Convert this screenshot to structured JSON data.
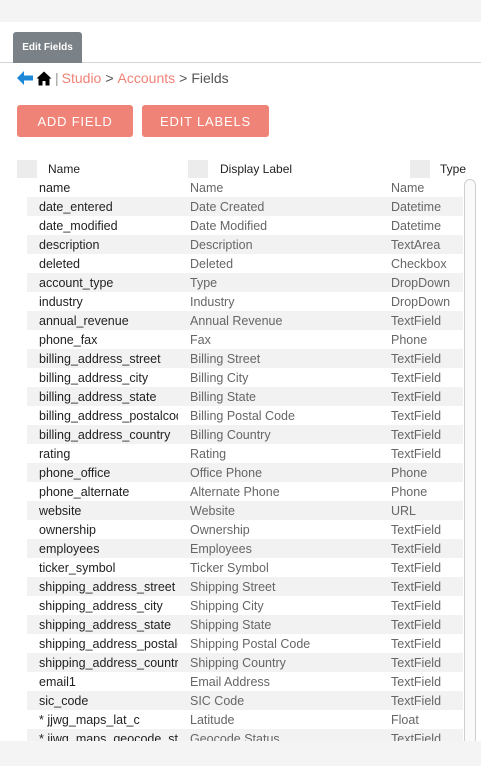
{
  "tab": {
    "label": "Edit Fields"
  },
  "breadcrumb": {
    "back_icon": "back-arrow-icon",
    "home_icon": "home-icon",
    "separator": "|",
    "studio": "Studio",
    "gt1": ">",
    "accounts": "Accounts",
    "gt2": ">",
    "current": "Fields"
  },
  "buttons": {
    "add_field": "ADD FIELD",
    "edit_labels": "EDIT LABELS"
  },
  "colors": {
    "accent": "#f08377",
    "tab": "#7a8288"
  },
  "table": {
    "headers": {
      "name": "Name",
      "label": "Display Label",
      "type": "Type"
    },
    "rows": [
      {
        "name": "name",
        "label": "Name",
        "type": "Name"
      },
      {
        "name": "date_entered",
        "label": "Date Created",
        "type": "Datetime"
      },
      {
        "name": "date_modified",
        "label": "Date Modified",
        "type": "Datetime"
      },
      {
        "name": "description",
        "label": "Description",
        "type": "TextArea"
      },
      {
        "name": "deleted",
        "label": "Deleted",
        "type": "Checkbox"
      },
      {
        "name": "account_type",
        "label": "Type",
        "type": "DropDown"
      },
      {
        "name": "industry",
        "label": "Industry",
        "type": "DropDown"
      },
      {
        "name": "annual_revenue",
        "label": "Annual Revenue",
        "type": "TextField"
      },
      {
        "name": "phone_fax",
        "label": "Fax",
        "type": "Phone"
      },
      {
        "name": "billing_address_street",
        "label": "Billing Street",
        "type": "TextField"
      },
      {
        "name": "billing_address_city",
        "label": "Billing City",
        "type": "TextField"
      },
      {
        "name": "billing_address_state",
        "label": "Billing State",
        "type": "TextField"
      },
      {
        "name": "billing_address_postalcode",
        "label": "Billing Postal Code",
        "type": "TextField"
      },
      {
        "name": "billing_address_country",
        "label": "Billing Country",
        "type": "TextField"
      },
      {
        "name": "rating",
        "label": "Rating",
        "type": "TextField"
      },
      {
        "name": "phone_office",
        "label": "Office Phone",
        "type": "Phone"
      },
      {
        "name": "phone_alternate",
        "label": "Alternate Phone",
        "type": "Phone"
      },
      {
        "name": "website",
        "label": "Website",
        "type": "URL"
      },
      {
        "name": "ownership",
        "label": "Ownership",
        "type": "TextField"
      },
      {
        "name": "employees",
        "label": "Employees",
        "type": "TextField"
      },
      {
        "name": "ticker_symbol",
        "label": "Ticker Symbol",
        "type": "TextField"
      },
      {
        "name": "shipping_address_street",
        "label": "Shipping Street",
        "type": "TextField"
      },
      {
        "name": "shipping_address_city",
        "label": "Shipping City",
        "type": "TextField"
      },
      {
        "name": "shipping_address_state",
        "label": "Shipping State",
        "type": "TextField"
      },
      {
        "name": "shipping_address_postalcode",
        "label": "Shipping Postal Code",
        "type": "TextField"
      },
      {
        "name": "shipping_address_country",
        "label": "Shipping Country",
        "type": "TextField"
      },
      {
        "name": "email1",
        "label": "Email Address",
        "type": "TextField"
      },
      {
        "name": "sic_code",
        "label": "SIC Code",
        "type": "TextField"
      },
      {
        "name": "* jjwg_maps_lat_c",
        "label": "Latitude",
        "type": "Float"
      },
      {
        "name": "* jjwg_maps_geocode_status_c",
        "label": "Geocode Status",
        "type": "TextField"
      }
    ]
  }
}
